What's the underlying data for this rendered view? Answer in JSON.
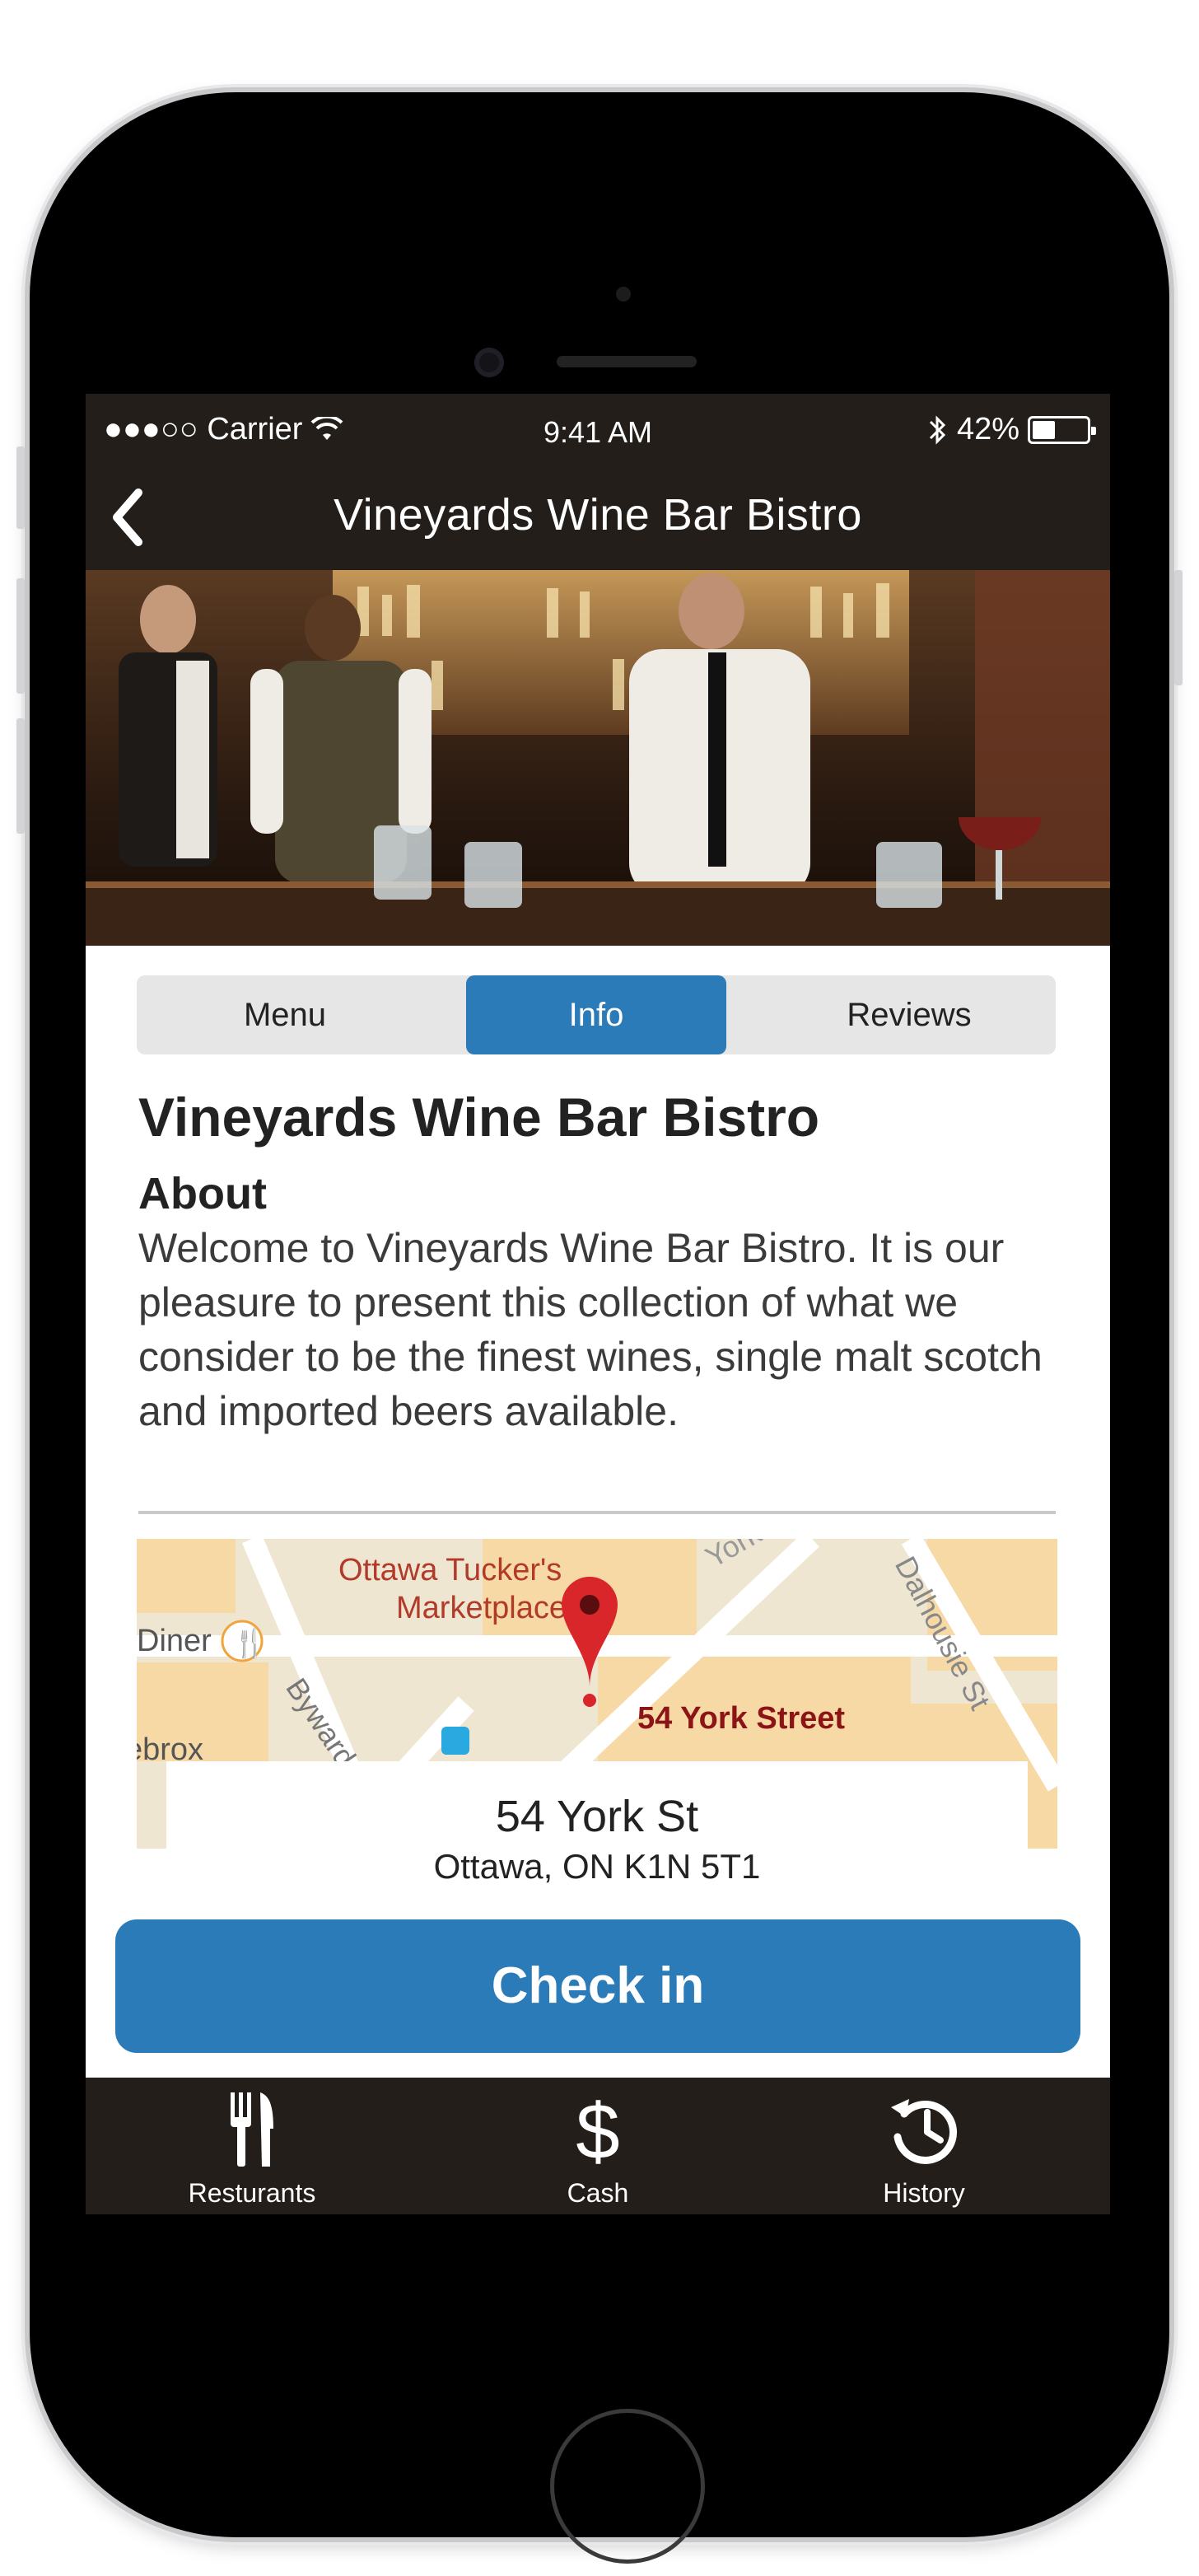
{
  "status_bar": {
    "signal_carrier": "●●●○○ Carrier",
    "time": "9:41 AM",
    "battery_percent": "42%",
    "battery_level": 0.42
  },
  "nav": {
    "title": "Vineyards Wine Bar Bistro",
    "back_icon": "chevron-left-icon"
  },
  "tabs": [
    {
      "label": "Menu",
      "active": false
    },
    {
      "label": "Info",
      "active": true
    },
    {
      "label": "Reviews",
      "active": false
    }
  ],
  "info": {
    "venue_name": "Vineyards Wine Bar Bistro",
    "about_heading": "About",
    "about_text": "Welcome to Vineyards Wine Bar Bistro. It is our pleasure to present this collection of what we consider to be the finest wines, single malt scotch and imported beers available."
  },
  "map": {
    "labels": {
      "tucker": "Ottawa Tucker's",
      "marketplace": "Marketplace",
      "diner": "Diner",
      "byward": "Byward",
      "york": "York",
      "dalhousie": "Dalhousie St",
      "ebrox": "ebrox",
      "pin": "54 York Street"
    }
  },
  "address": {
    "street": "54 York St",
    "city": "Ottawa, ON K1N 5T1"
  },
  "checkin_label": "Check in",
  "tabbar": [
    {
      "label": "Resturants",
      "icon": "fork-knife-icon"
    },
    {
      "label": "Cash",
      "icon": "dollar-icon"
    },
    {
      "label": "History",
      "icon": "history-icon"
    }
  ],
  "colors": {
    "bar_bg": "#231e19",
    "accent": "#2b7bb8",
    "segment_bg": "#e6e6e6",
    "pin": "#d9262b"
  }
}
